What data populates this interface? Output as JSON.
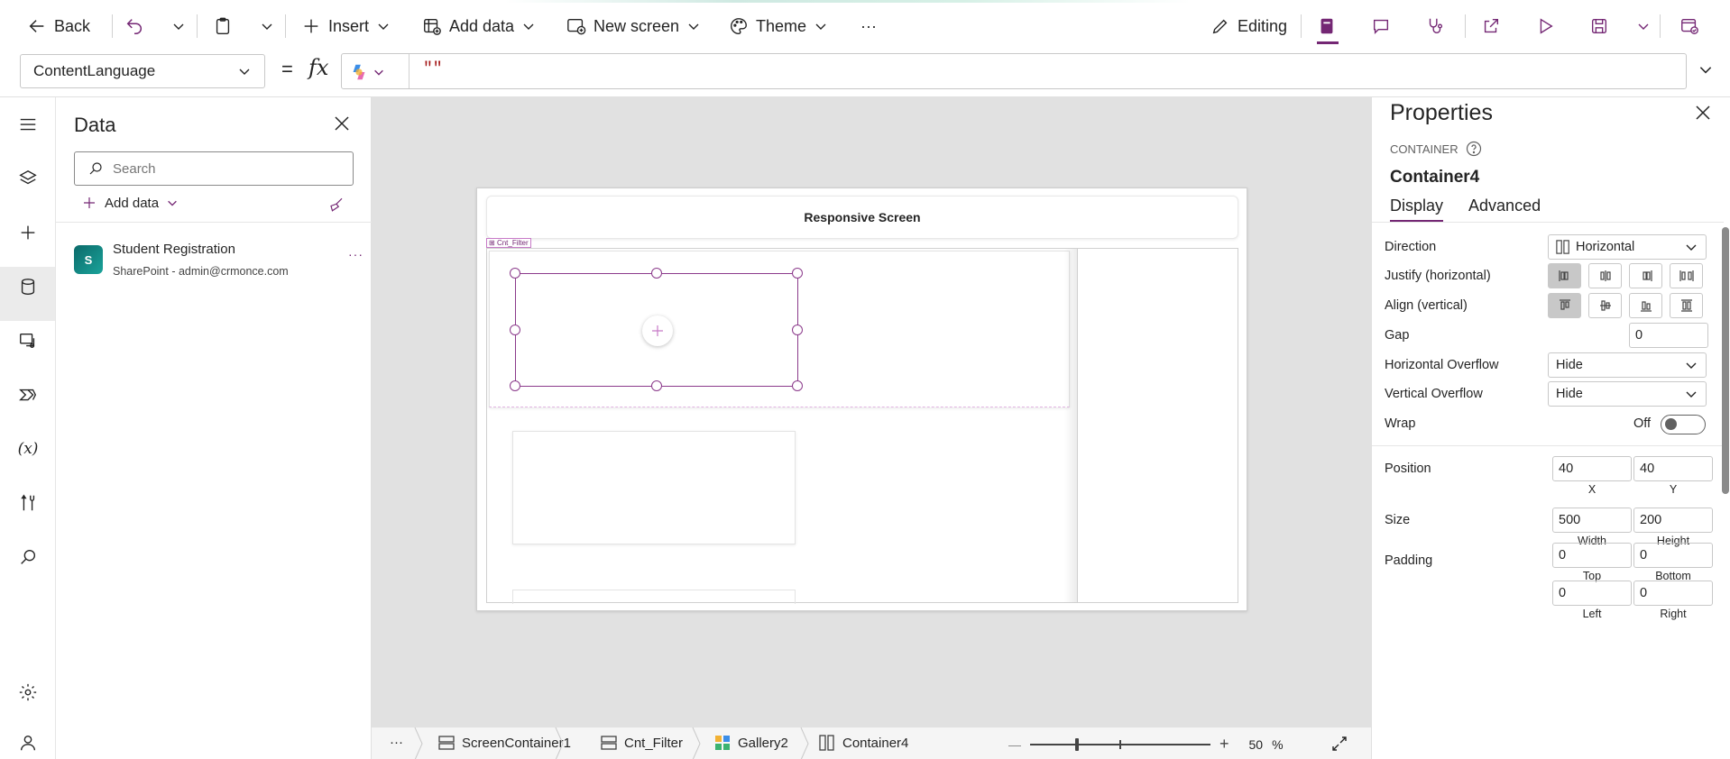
{
  "toolbar": {
    "back": "Back",
    "insert": "Insert",
    "add_data": "Add data",
    "new_screen": "New screen",
    "theme": "Theme",
    "more": "···",
    "editing": "Editing"
  },
  "formula_bar": {
    "property": "ContentLanguage",
    "equals": "=",
    "fx": "fx",
    "value": "\"\""
  },
  "data_pane": {
    "title": "Data",
    "search_placeholder": "Search",
    "add_data": "Add data",
    "source": {
      "icon_text": "S",
      "name": "Student Registration",
      "subtitle": "SharePoint - admin@crmonce.com",
      "more": "···"
    }
  },
  "canvas": {
    "header_text": "Responsive Screen",
    "container_label": "Cnt_Filter"
  },
  "status_bar": {
    "more": "···",
    "crumbs": [
      "ScreenContainer1",
      "Cnt_Filter",
      "Gallery2",
      "Container4"
    ],
    "zoom_minus": "—",
    "zoom_plus": "+",
    "zoom_value": "50",
    "zoom_unit": "%"
  },
  "properties": {
    "title": "Properties",
    "kind": "CONTAINER",
    "name": "Container4",
    "tabs": [
      "Display",
      "Advanced"
    ],
    "direction_label": "Direction",
    "direction_value": "Horizontal",
    "justify_label": "Justify (horizontal)",
    "align_label": "Align (vertical)",
    "gap_label": "Gap",
    "gap_value": "0",
    "h_overflow_label": "Horizontal Overflow",
    "h_overflow_value": "Hide",
    "v_overflow_label": "Vertical Overflow",
    "v_overflow_value": "Hide",
    "wrap_label": "Wrap",
    "wrap_value": "Off",
    "position_label": "Position",
    "pos_x": "40",
    "pos_y": "40",
    "x_cap": "X",
    "y_cap": "Y",
    "size_label": "Size",
    "width": "500",
    "height": "200",
    "width_cap": "Width",
    "height_cap": "Height",
    "padding_label": "Padding",
    "pad_top": "0",
    "pad_bottom": "0",
    "pad_left": "0",
    "pad_right": "0",
    "top_cap": "Top",
    "bottom_cap": "Bottom",
    "left_cap": "Left",
    "right_cap": "Right"
  },
  "colors": {
    "accent": "#742774",
    "selection": "#8b3a8b",
    "canvas_bg": "#e1e1e1"
  }
}
